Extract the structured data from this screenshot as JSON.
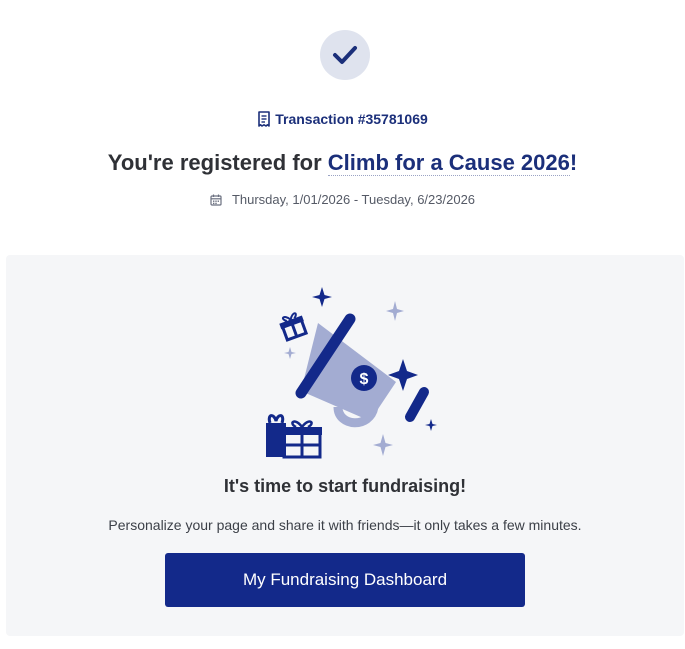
{
  "status": {
    "icon": "check-icon"
  },
  "transaction": {
    "icon": "receipt-icon",
    "label": "Transaction #35781069"
  },
  "headline": {
    "prefix": "You're registered for ",
    "event_name": "Climb for a Cause 2026",
    "suffix": "!"
  },
  "dates": {
    "icon": "calendar-icon",
    "range": "Thursday, 1/01/2026 - Tuesday, 6/23/2026"
  },
  "fundraising": {
    "illustration": "megaphone-illustration",
    "title": "It's time to start fundraising!",
    "description": "Personalize your page and share it with friends—it only takes a few minutes.",
    "button_label": "My Fundraising Dashboard"
  },
  "colors": {
    "brand_navy": "#13298a",
    "link_navy": "#1b2f7a",
    "badge_bg": "#dfe3ee",
    "panel_bg": "#f5f6f8",
    "illustration_light": "#a3acd2"
  }
}
